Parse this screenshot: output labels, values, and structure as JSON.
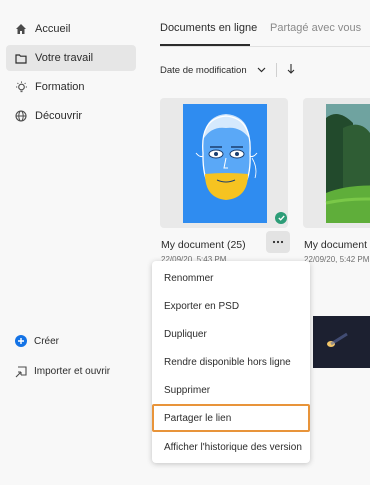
{
  "sidebar": {
    "items": [
      {
        "label": "Accueil",
        "icon": "home-icon"
      },
      {
        "label": "Votre travail",
        "icon": "folder-icon",
        "active": true
      },
      {
        "label": "Formation",
        "icon": "lightbulb-icon"
      },
      {
        "label": "Découvrir",
        "icon": "globe-icon"
      }
    ],
    "bottom": [
      {
        "label": "Créer",
        "icon": "plus-circle-icon"
      },
      {
        "label": "Importer et ouvrir",
        "icon": "import-icon"
      }
    ]
  },
  "tabs": [
    {
      "label": "Documents en ligne",
      "active": true
    },
    {
      "label": "Partagé avec vous"
    }
  ],
  "sort": {
    "label": "Date de modification"
  },
  "cards": [
    {
      "title": "My document (25)",
      "date": "22/09/20, 5:43 PM",
      "synced": true
    },
    {
      "title": "My document (",
      "date": "22/09/20, 5:42 PM"
    }
  ],
  "context_menu": {
    "items": [
      {
        "label": "Renommer"
      },
      {
        "label": "Exporter en PSD"
      },
      {
        "label": "Dupliquer"
      },
      {
        "label": "Rendre disponible hors ligne"
      },
      {
        "label": "Supprimer"
      },
      {
        "label": "Partager le lien",
        "highlighted": true
      },
      {
        "label": "Afficher l'historique des version"
      }
    ]
  },
  "colors": {
    "accent_blue": "#1473e6",
    "sync_green": "#2d9d78",
    "focus_orange": "#e8943a"
  }
}
